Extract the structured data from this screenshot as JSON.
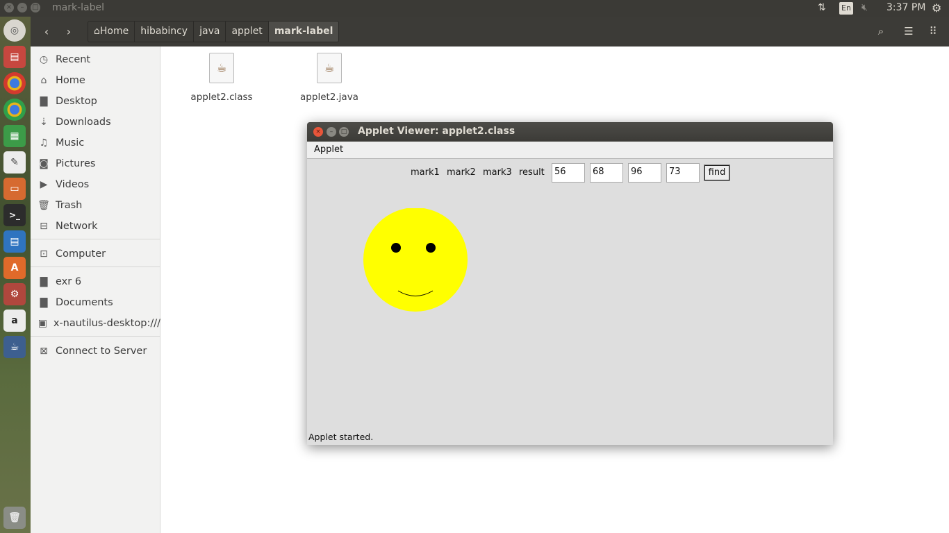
{
  "top_panel": {
    "window_title": "mark-label",
    "language": "En",
    "clock": "3:37 PM",
    "icons": [
      "close-icon",
      "minimize-icon",
      "maximize-icon",
      "network-arrows-icon",
      "volume-muted-icon",
      "settings-gear-icon"
    ]
  },
  "toolbar": {
    "back_icon": "‹",
    "forward_icon": "›",
    "breadcrumbs": [
      {
        "label": "Home"
      },
      {
        "label": "hibabincy"
      },
      {
        "label": "java"
      },
      {
        "label": "applet"
      },
      {
        "label": "mark-label"
      }
    ],
    "right_icons": [
      "search-icon",
      "list-view-icon",
      "grid-view-icon"
    ]
  },
  "sidebar": {
    "items": [
      {
        "label": "Recent",
        "icon": "clock-icon"
      },
      {
        "label": "Home",
        "icon": "home-icon"
      },
      {
        "label": "Desktop",
        "icon": "folder-icon"
      },
      {
        "label": "Downloads",
        "icon": "download-icon"
      },
      {
        "label": "Music",
        "icon": "music-icon"
      },
      {
        "label": "Pictures",
        "icon": "camera-icon"
      },
      {
        "label": "Videos",
        "icon": "video-icon"
      },
      {
        "label": "Trash",
        "icon": "trash-icon"
      },
      {
        "label": "Network",
        "icon": "network-icon"
      },
      {
        "label": "Computer",
        "icon": "drive-icon"
      },
      {
        "label": "exr 6",
        "icon": "folder-icon"
      },
      {
        "label": "Documents",
        "icon": "folder-icon"
      },
      {
        "label": "x-nautilus-desktop:///",
        "icon": "desktop-icon"
      },
      {
        "label": "Connect to Server",
        "icon": "server-icon"
      }
    ]
  },
  "files": [
    {
      "name": "applet2.class",
      "icon": "java-coffee-icon"
    },
    {
      "name": "applet2.java",
      "icon": "java-coffee-icon"
    }
  ],
  "applet_viewer": {
    "title": "Applet Viewer: applet2.class",
    "menu": "Applet",
    "labels": {
      "mark1": "mark1",
      "mark2": "mark2",
      "mark3": "mark3",
      "result": "result"
    },
    "fields": {
      "mark1": "56",
      "mark2": "68",
      "mark3": "96",
      "result": "73"
    },
    "find_label": "find",
    "status": "Applet started.",
    "colors": {
      "face": "#ffff00",
      "features": "#000000",
      "background": "#dedede"
    }
  },
  "colors": {
    "panel": "#3b3a36",
    "toolbar": "#3c3b37",
    "close_button": "#e8553a"
  }
}
